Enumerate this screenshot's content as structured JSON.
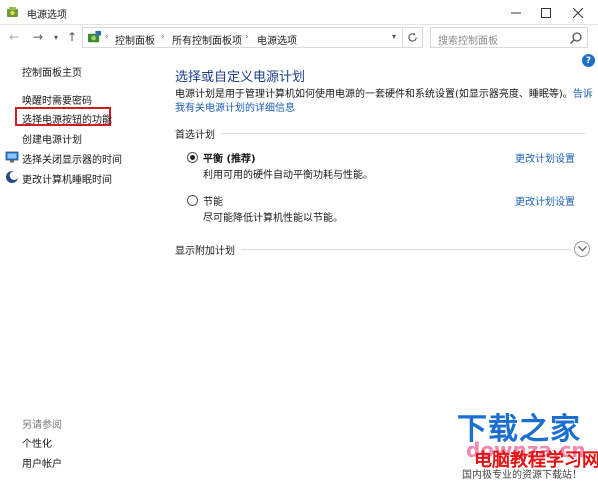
{
  "window": {
    "title": "电源选项",
    "icon": "power-options-icon",
    "minimize_icon": "minimize-icon",
    "maximize_icon": "maximize-icon",
    "close_icon": "close-icon"
  },
  "address_bar": {
    "breadcrumbs": [
      "控制面板",
      "所有控制面板项",
      "电源选项"
    ],
    "search_placeholder": "搜索控制面板"
  },
  "sidebar": {
    "home": "控制面板主页",
    "items": [
      {
        "label": "唤醒时需要密码",
        "icon": ""
      },
      {
        "label": "选择电源按钮的功能",
        "icon": ""
      },
      {
        "label": "创建电源计划",
        "icon": ""
      },
      {
        "label": "选择关闭显示器的时间",
        "icon": "display-off-icon"
      },
      {
        "label": "更改计算机睡眠时间",
        "icon": "sleep-moon-icon"
      }
    ],
    "see_also": "另请参阅",
    "see_also_items": [
      "个性化",
      "用户帐户"
    ]
  },
  "main": {
    "title": "选择或自定义电源计划",
    "description": "电源计划是用于管理计算机如何使用电源的一套硬件和系统设置(如显示器亮度、睡眠等)。",
    "description_link": "告诉我有关电源计划的详细信息",
    "preferred_label": "首选计划",
    "plans": [
      {
        "name": "平衡 (推荐)",
        "description": "利用可用的硬件自动平衡功耗与性能。",
        "link": "更改计划设置",
        "selected": true
      },
      {
        "name": "节能",
        "description": "尽可能降低计算机性能以节能。",
        "link": "更改计划设置",
        "selected": false
      }
    ],
    "extra_plans_label": "显示附加计划"
  },
  "watermark": {
    "brand": "下载之家",
    "url": "downza.cn",
    "site": "电脑教程学习网",
    "tagline": "国内极专业的资源下载站！"
  },
  "colors": {
    "link": "#1c5fb4",
    "title": "#1c3f8e",
    "highlight_box": "#d01c24",
    "help": "#1e6fc6"
  }
}
